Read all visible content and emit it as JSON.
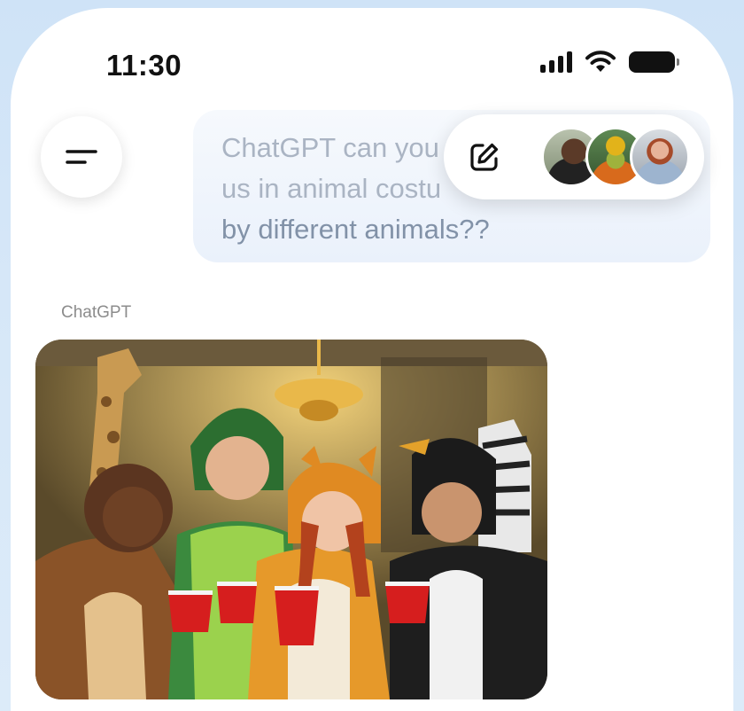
{
  "status_bar": {
    "time": "11:30"
  },
  "icons": {
    "menu": "menu-icon",
    "edit": "compose-icon",
    "signal": "signal-icon",
    "wifi": "wifi-icon",
    "battery": "battery-icon"
  },
  "chat": {
    "user_message_faded": "ChatGPT can you\nus in animal costu",
    "user_message_visible": "by different animals??",
    "assistant_name": "ChatGPT"
  },
  "colors": {
    "background": "#d6e7f8",
    "bubble": "#eef3fb",
    "faded_text": "#aab4c3",
    "text": "#8292a8"
  }
}
